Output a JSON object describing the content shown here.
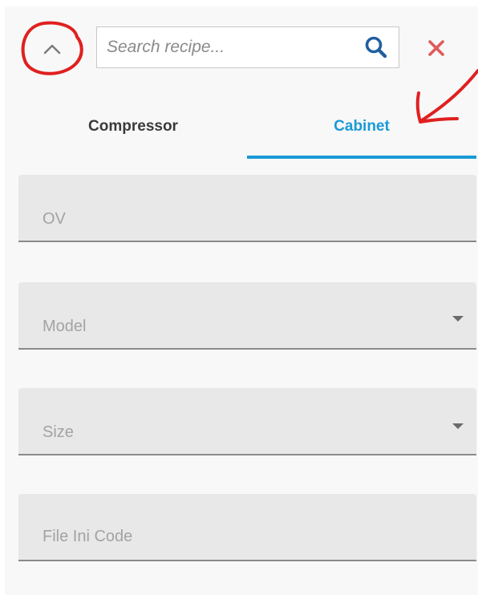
{
  "search": {
    "placeholder": "Search recipe..."
  },
  "tabs": [
    {
      "label": "Compressor",
      "active": false
    },
    {
      "label": "Cabinet",
      "active": true
    }
  ],
  "fields": [
    {
      "label": "OV",
      "type": "text"
    },
    {
      "label": "Model",
      "type": "select"
    },
    {
      "label": "Size",
      "type": "select"
    },
    {
      "label": "File Ini Code",
      "type": "text"
    }
  ],
  "colors": {
    "accent": "#1a9ad6",
    "close": "#e05a5a",
    "annotation": "#e02020"
  },
  "icons": [
    "chevron-up-icon",
    "search-icon",
    "close-icon",
    "dropdown-arrow-icon"
  ]
}
